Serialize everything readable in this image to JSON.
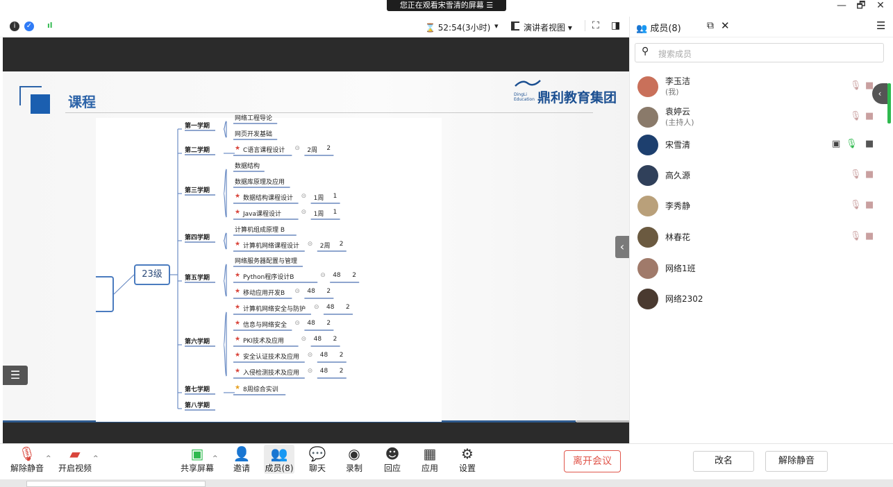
{
  "window": {
    "share_banner": "您正在观看宋雪清的屏幕 ☰",
    "controls": [
      "—",
      "🗗",
      "✕"
    ]
  },
  "header": {
    "timer": "⌛ 52:54(3小时)",
    "timer_caret": "▾",
    "view_mode": "演讲者视图 ▾",
    "fullscreen_icon": "⛶",
    "layout_icon": "◨"
  },
  "slide": {
    "title": "课程",
    "logo_text": "鼎利教育集团",
    "logo_sub": "DingLi\nEducation",
    "root_label": "23级",
    "semesters": [
      {
        "name": "第一学期",
        "courses": [
          {
            "name": "网络工程导论",
            "star": false
          },
          {
            "name": "网页开发基础",
            "star": false
          }
        ]
      },
      {
        "name": "第二学期",
        "courses": [
          {
            "name": "C语言课程设计",
            "star": true,
            "a": "2周",
            "b": "2"
          }
        ]
      },
      {
        "name": "第三学期",
        "courses": [
          {
            "name": "数据结构",
            "star": false
          },
          {
            "name": "数据库原理及应用",
            "star": false
          },
          {
            "name": "数据结构课程设计",
            "star": true,
            "a": "1周",
            "b": "1"
          },
          {
            "name": "Java课程设计",
            "star": true,
            "a": "1周",
            "b": "1"
          }
        ]
      },
      {
        "name": "第四学期",
        "courses": [
          {
            "name": "计算机组成原理 B",
            "star": false
          },
          {
            "name": "计算机网络课程设计",
            "star": true,
            "a": "2周",
            "b": "2"
          }
        ]
      },
      {
        "name": "第五学期",
        "courses": [
          {
            "name": "网络服务器配置与管理",
            "star": false
          },
          {
            "name": "Python程序设计B",
            "star": true,
            "a": "48",
            "b": "2"
          },
          {
            "name": "移动应用开发B",
            "star": true,
            "a": "48",
            "b": "2"
          }
        ]
      },
      {
        "name": "第六学期",
        "courses": [
          {
            "name": "计算机网络安全与防护",
            "star": true,
            "a": "48",
            "b": "2"
          },
          {
            "name": "信息与网络安全",
            "star": true,
            "a": "48",
            "b": "2"
          },
          {
            "name": "PKI技术及应用",
            "star": true,
            "a": "48",
            "b": "2"
          },
          {
            "name": "安全认证技术及应用",
            "star": true,
            "a": "48",
            "b": "2"
          },
          {
            "name": "入侵检测技术及应用",
            "star": true,
            "a": "48",
            "b": "2"
          }
        ]
      },
      {
        "name": "第七学期",
        "courses": [
          {
            "name": "8周综合实训",
            "star": true,
            "gold": true
          }
        ]
      },
      {
        "name": "第八学期",
        "courses": []
      }
    ]
  },
  "toolbar": {
    "unmute": "解除静音",
    "start_video": "开启视频",
    "share_screen": "共享屏幕",
    "invite": "邀请",
    "members": "成员(8)",
    "chat": "聊天",
    "record": "录制",
    "reactions": "回应",
    "apps": "应用",
    "settings": "设置",
    "leave": "离开会议"
  },
  "panel": {
    "tab_title": "成员(8)",
    "search_placeholder": "搜索成员",
    "members": [
      {
        "name": "李玉洁",
        "role": "(我)",
        "color": "#c9705a"
      },
      {
        "name": "袁婷云",
        "role": "(主持人)",
        "color": "#8a7a6a"
      },
      {
        "name": "宋雪清",
        "role": "",
        "color": "#1d3f6e"
      },
      {
        "name": "高久源",
        "role": "",
        "color": "#30405a"
      },
      {
        "name": "李秀静",
        "role": "",
        "color": "#b9a07a"
      },
      {
        "name": "林春花",
        "role": "",
        "color": "#6b5a40"
      },
      {
        "name": "网络1班",
        "role": "",
        "color": "#a07a6a"
      },
      {
        "name": "网络2302",
        "role": "",
        "color": "#4a3a30"
      }
    ],
    "rename": "改名",
    "unmute_all": "解除静音"
  }
}
